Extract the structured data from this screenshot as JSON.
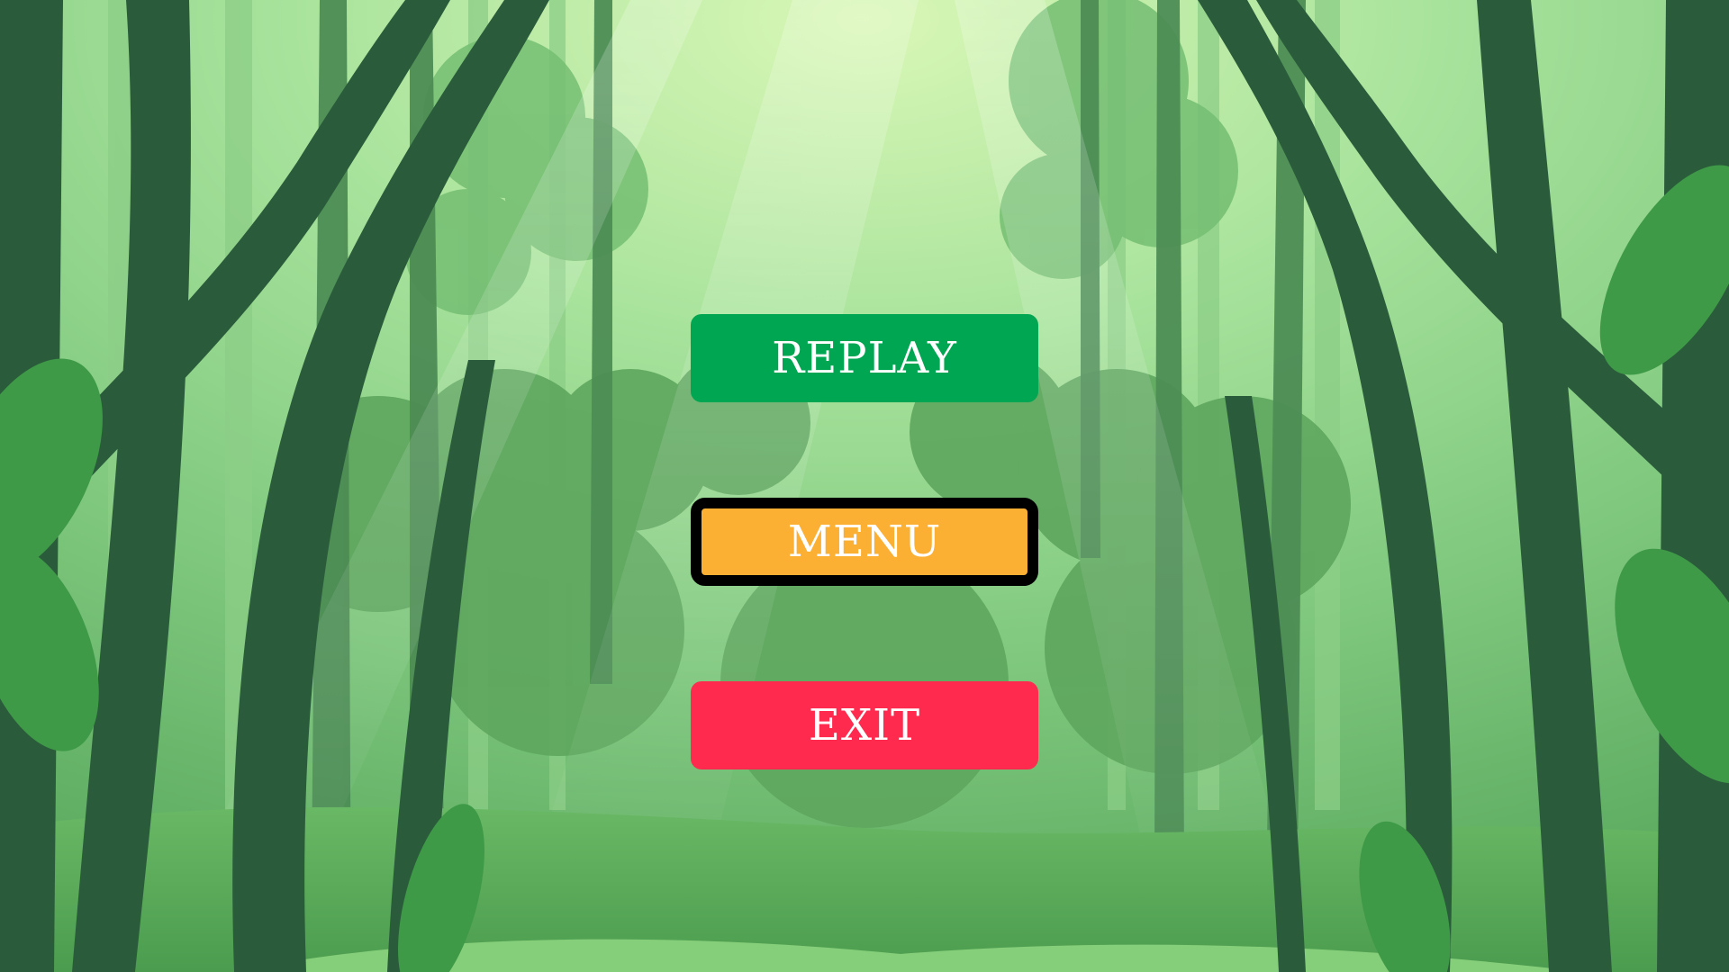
{
  "game_menu": {
    "buttons": [
      {
        "id": "replay",
        "label": "REPLAY",
        "color": "#00a651",
        "selected": false
      },
      {
        "id": "menu",
        "label": "MENU",
        "color": "#fbb034",
        "selected": true
      },
      {
        "id": "exit",
        "label": "EXIT",
        "color": "#ff2a4e",
        "selected": false
      }
    ],
    "selected_border_color": "#000000",
    "label_color": "#ffffff"
  },
  "background": {
    "scene": "green-forest",
    "sky_glow": "#d9f7b6",
    "haze": "#8fd58c",
    "mid_tree": "#3f7f4a",
    "dark_tree": "#24543a",
    "foliage": "#43a04a",
    "ground": "#5eb45b"
  }
}
